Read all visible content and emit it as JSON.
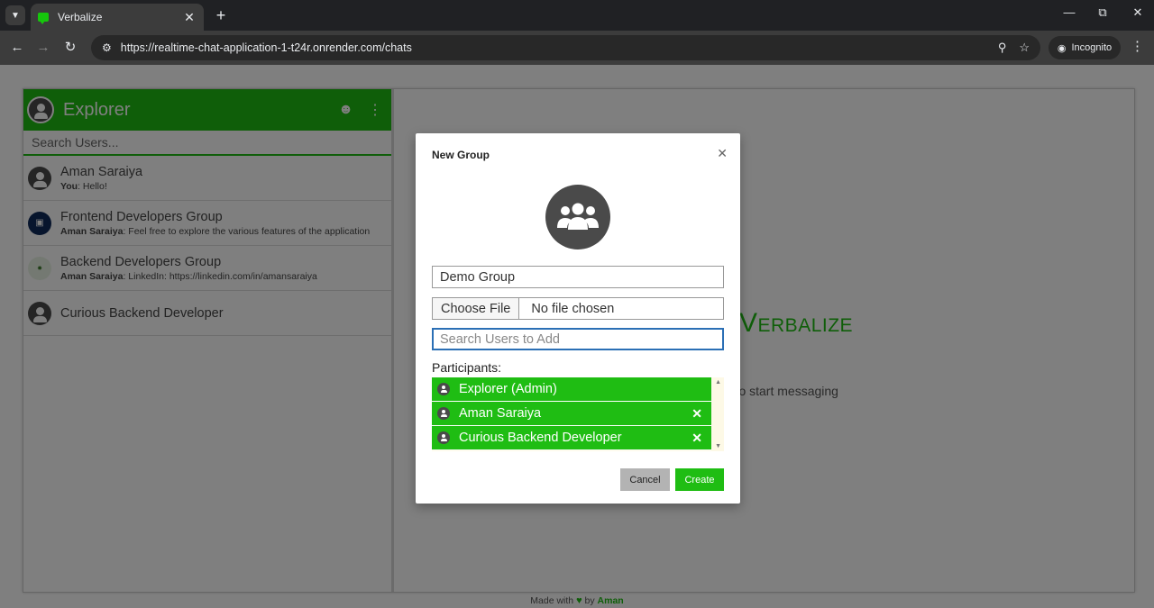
{
  "browser": {
    "tab_title": "Verbalize",
    "url": "https://realtime-chat-application-1-t24r.onrender.com/chats",
    "incognito_label": "Incognito"
  },
  "sidebar": {
    "title": "Explorer",
    "search_placeholder": "Search Users...",
    "chats": [
      {
        "name": "Aman Saraiya",
        "sender": "You",
        "message": ": Hello!"
      },
      {
        "name": "Frontend Developers Group",
        "sender": "Aman Saraiya",
        "message": ": Feel free to explore the various features of the application"
      },
      {
        "name": "Backend Developers Group",
        "sender": "Aman Saraiya",
        "message": ": LinkedIn: https://linkedin.com/in/amansaraiya"
      },
      {
        "name": "Curious Backend Developer",
        "sender": "",
        "message": ""
      }
    ]
  },
  "main": {
    "brand": "Verbalize",
    "subtitle": "at to start messaging"
  },
  "footer": {
    "prefix": "Made with",
    "by": "by",
    "author": "Aman"
  },
  "modal": {
    "title": "New Group",
    "group_name_value": "Demo Group",
    "file_button_label": "Choose File",
    "file_status": "No file chosen",
    "search_placeholder": "Search Users to Add",
    "participants_label": "Participants:",
    "participants": [
      {
        "name": "Explorer (Admin)",
        "removable": false
      },
      {
        "name": "Aman Saraiya",
        "removable": true
      },
      {
        "name": "Curious Backend Developer",
        "removable": true
      }
    ],
    "cancel_label": "Cancel",
    "create_label": "Create"
  },
  "colors": {
    "accent": "#1fbd13",
    "chrome_dark": "#202124",
    "chrome_toolbar": "#3c3c3c"
  }
}
